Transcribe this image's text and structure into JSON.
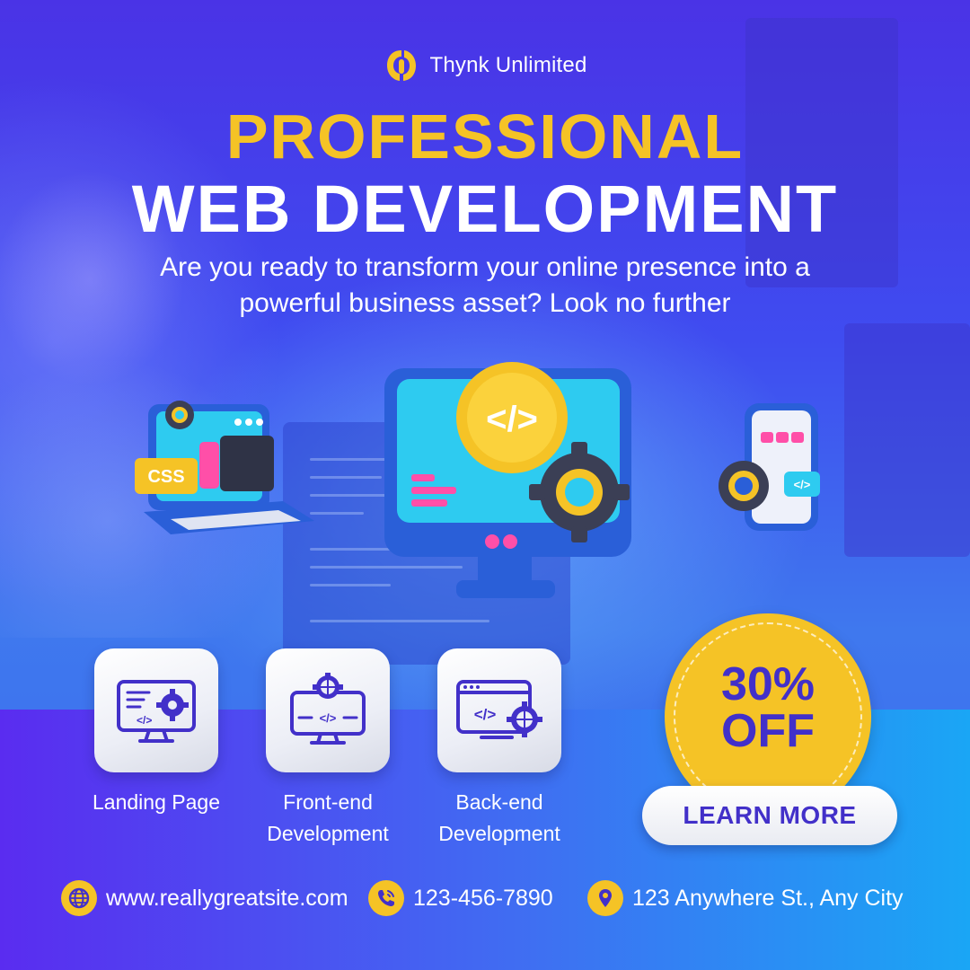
{
  "brand": {
    "name": "Thynk Unlimited",
    "logo_icon": "thynk-logo-icon"
  },
  "headline": {
    "line1": "PROFESSIONAL",
    "line2": "WEB DEVELOPMENT"
  },
  "subtitle": "Are you ready to transform your online presence into a powerful business asset? Look no further",
  "services": [
    {
      "label": "Landing Page",
      "icon": "monitor-gear-icon"
    },
    {
      "label": "Front-end Development",
      "icon": "monitor-globe-code-icon"
    },
    {
      "label": "Back-end Development",
      "icon": "browser-code-globe-icon"
    }
  ],
  "offer": {
    "percent": "30%",
    "off": "OFF",
    "button_label": "LEARN MORE"
  },
  "contact": {
    "website": "www.reallygreatsite.com",
    "phone": "123-456-7890",
    "address": "123 Anywhere St., Any City"
  },
  "colors": {
    "accent_yellow": "#f5c326",
    "brand_purple": "#4230c9",
    "background_blue": "#3f4cf0",
    "text_white": "#ffffff"
  }
}
